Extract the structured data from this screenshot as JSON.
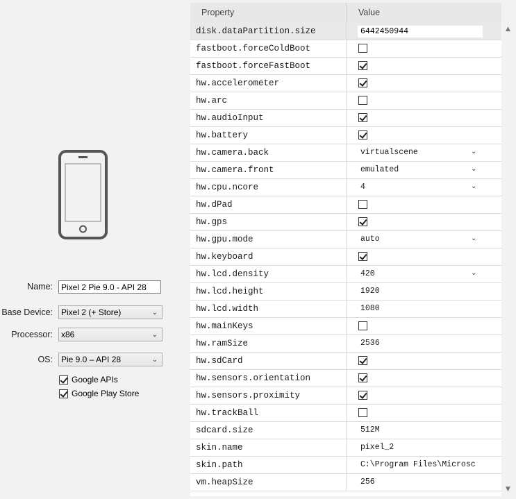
{
  "left_panel": {
    "device_icon": "phone-icon",
    "name_label": "Name:",
    "name_value": "Pixel 2 Pie 9.0 - API 28",
    "base_device_label": "Base Device:",
    "base_device_value": "Pixel 2 (+ Store)",
    "processor_label": "Processor:",
    "processor_value": "x86",
    "os_label": "OS:",
    "os_value": "Pie 9.0 – API 28",
    "google_apis_label": "Google APIs",
    "google_play_label": "Google Play Store"
  },
  "grid": {
    "header_property": "Property",
    "header_value": "Value",
    "rows": [
      {
        "prop": "disk.dataPartition.size",
        "kind": "text",
        "value": "6442450944"
      },
      {
        "prop": "fastboot.forceColdBoot",
        "kind": "check",
        "checked": false
      },
      {
        "prop": "fastboot.forceFastBoot",
        "kind": "check",
        "checked": true
      },
      {
        "prop": "hw.accelerometer",
        "kind": "check",
        "checked": true
      },
      {
        "prop": "hw.arc",
        "kind": "check",
        "checked": false
      },
      {
        "prop": "hw.audioInput",
        "kind": "check",
        "checked": true
      },
      {
        "prop": "hw.battery",
        "kind": "check",
        "checked": true
      },
      {
        "prop": "hw.camera.back",
        "kind": "dropdown",
        "value": "virtualscene"
      },
      {
        "prop": "hw.camera.front",
        "kind": "dropdown",
        "value": "emulated"
      },
      {
        "prop": "hw.cpu.ncore",
        "kind": "dropdown",
        "value": "4"
      },
      {
        "prop": "hw.dPad",
        "kind": "check",
        "checked": false
      },
      {
        "prop": "hw.gps",
        "kind": "check",
        "checked": true
      },
      {
        "prop": "hw.gpu.mode",
        "kind": "dropdown",
        "value": "auto"
      },
      {
        "prop": "hw.keyboard",
        "kind": "check",
        "checked": true
      },
      {
        "prop": "hw.lcd.density",
        "kind": "dropdown",
        "value": "420"
      },
      {
        "prop": "hw.lcd.height",
        "kind": "text",
        "value": "1920"
      },
      {
        "prop": "hw.lcd.width",
        "kind": "text",
        "value": "1080"
      },
      {
        "prop": "hw.mainKeys",
        "kind": "check",
        "checked": false
      },
      {
        "prop": "hw.ramSize",
        "kind": "text",
        "value": "2536"
      },
      {
        "prop": "hw.sdCard",
        "kind": "check",
        "checked": true
      },
      {
        "prop": "hw.sensors.orientation",
        "kind": "check",
        "checked": true
      },
      {
        "prop": "hw.sensors.proximity",
        "kind": "check",
        "checked": true
      },
      {
        "prop": "hw.trackBall",
        "kind": "check",
        "checked": false
      },
      {
        "prop": "sdcard.size",
        "kind": "text",
        "value": "512M"
      },
      {
        "prop": "skin.name",
        "kind": "text",
        "value": "pixel_2"
      },
      {
        "prop": "skin.path",
        "kind": "text",
        "value": "C:\\Program Files\\Microsc"
      },
      {
        "prop": "vm.heapSize",
        "kind": "text",
        "value": "256"
      }
    ]
  }
}
